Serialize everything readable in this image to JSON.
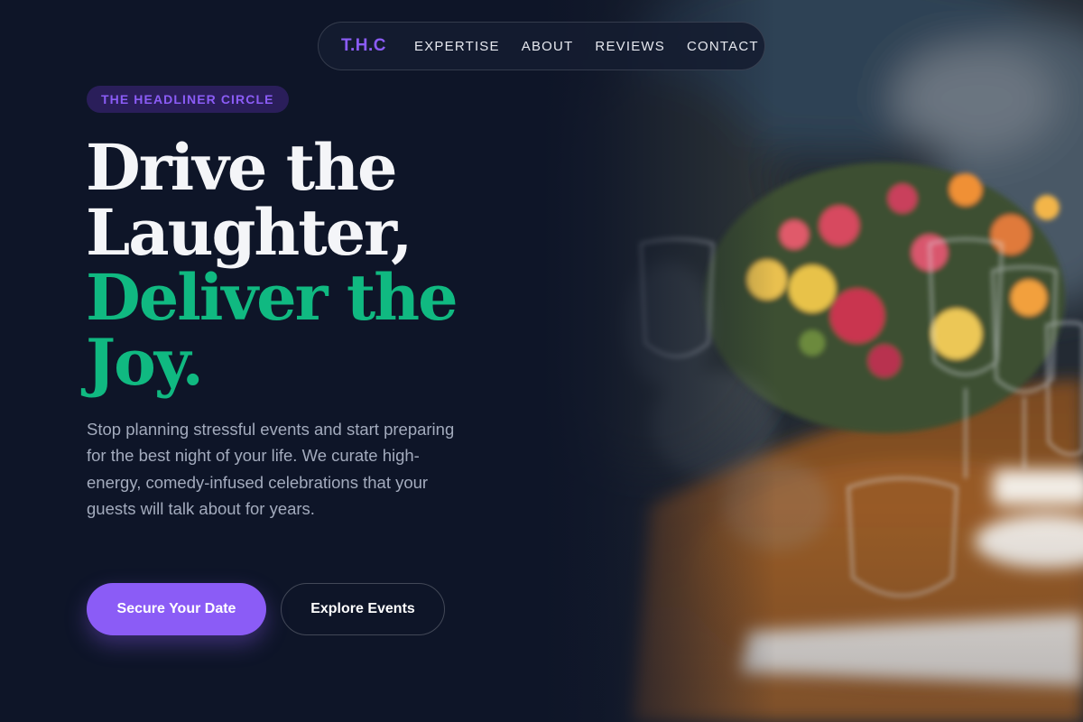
{
  "nav": {
    "brand": "T.H.C",
    "links": [
      {
        "label": "EXPERTISE"
      },
      {
        "label": "ABOUT"
      },
      {
        "label": "REVIEWS"
      },
      {
        "label": "CONTACT"
      }
    ]
  },
  "hero": {
    "badge": "THE HEADLINER CIRCLE",
    "headline_lines": [
      "Drive the",
      "Laughter,",
      "Deliver the",
      "Joy."
    ],
    "description": "Stop planning stressful events and start preparing for the best night of your life. We curate high-energy, comedy-infused celebrations that your guests will talk about for years.",
    "primary_cta": "Secure Your Date",
    "secondary_cta": "Explore Events"
  },
  "colors": {
    "background": "#0e1528",
    "accent_purple": "#8b5cf6",
    "accent_green": "#10b981",
    "text_muted": "#a3abbd"
  }
}
